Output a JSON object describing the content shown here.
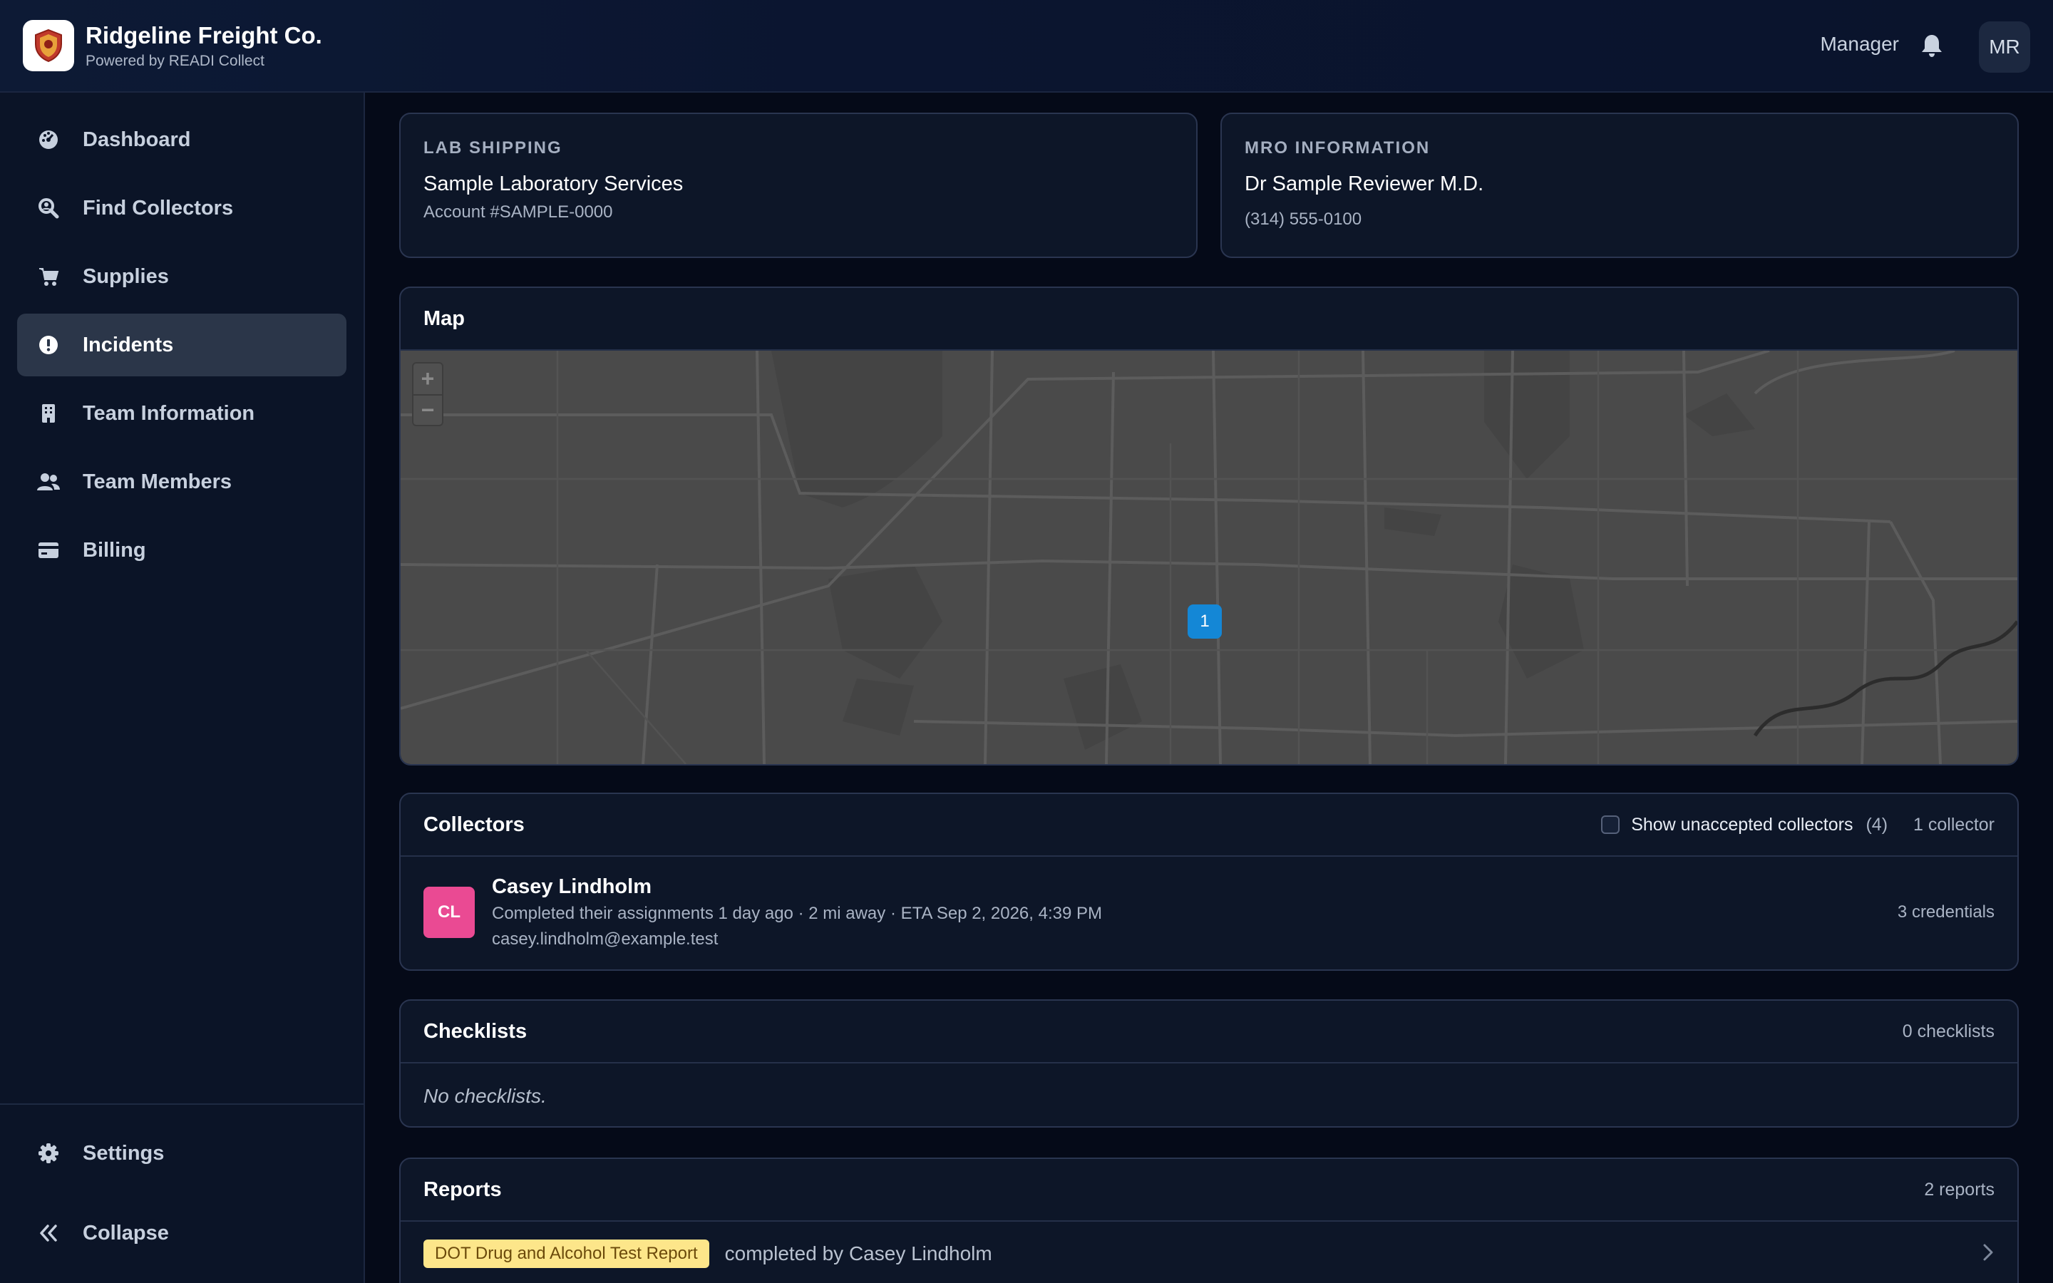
{
  "header": {
    "company": "Ridgeline Freight Co.",
    "subtitle": "Powered by READI Collect",
    "role": "Manager",
    "user_initials": "MR"
  },
  "sidebar": {
    "items": [
      {
        "label": "Dashboard",
        "icon": "gauge-icon"
      },
      {
        "label": "Find Collectors",
        "icon": "search-person-icon"
      },
      {
        "label": "Supplies",
        "icon": "cart-icon"
      },
      {
        "label": "Incidents",
        "icon": "alert-circle-icon",
        "active": true
      },
      {
        "label": "Team Information",
        "icon": "building-icon"
      },
      {
        "label": "Team Members",
        "icon": "users-icon"
      },
      {
        "label": "Billing",
        "icon": "credit-card-icon"
      }
    ],
    "settings_label": "Settings",
    "collapse_label": "Collapse"
  },
  "lab_shipping": {
    "label": "LAB SHIPPING",
    "name": "Sample Laboratory Services",
    "account": "Account #SAMPLE-0000"
  },
  "mro": {
    "label": "MRO INFORMATION",
    "name": "Dr Sample Reviewer M.D.",
    "phone": "(314) 555-0100"
  },
  "map": {
    "title": "Map",
    "zoom_in": "+",
    "zoom_out": "−",
    "marker_count": "1"
  },
  "collectors": {
    "title": "Collectors",
    "toggle_label": "Show unaccepted collectors",
    "unaccepted_count": "(4)",
    "count_label": "1 collector",
    "items": [
      {
        "initials": "CL",
        "name": "Casey Lindholm",
        "detail": "Completed their assignments 1 day ago · 2 mi away · ETA Sep 2, 2026, 4:39 PM",
        "email": "casey.lindholm@example.test",
        "credentials": "3 credentials"
      }
    ]
  },
  "checklists": {
    "title": "Checklists",
    "count_label": "0 checklists",
    "empty": "No checklists."
  },
  "reports": {
    "title": "Reports",
    "count_label": "2 reports",
    "items": [
      {
        "badge": "DOT Drug and Alcohol Test Report",
        "text": "completed by Casey Lindholm"
      }
    ]
  },
  "colors": {
    "accent": "#1487d6",
    "avatar_pink": "#ea4a93",
    "badge_yellow": "#fde68a"
  }
}
